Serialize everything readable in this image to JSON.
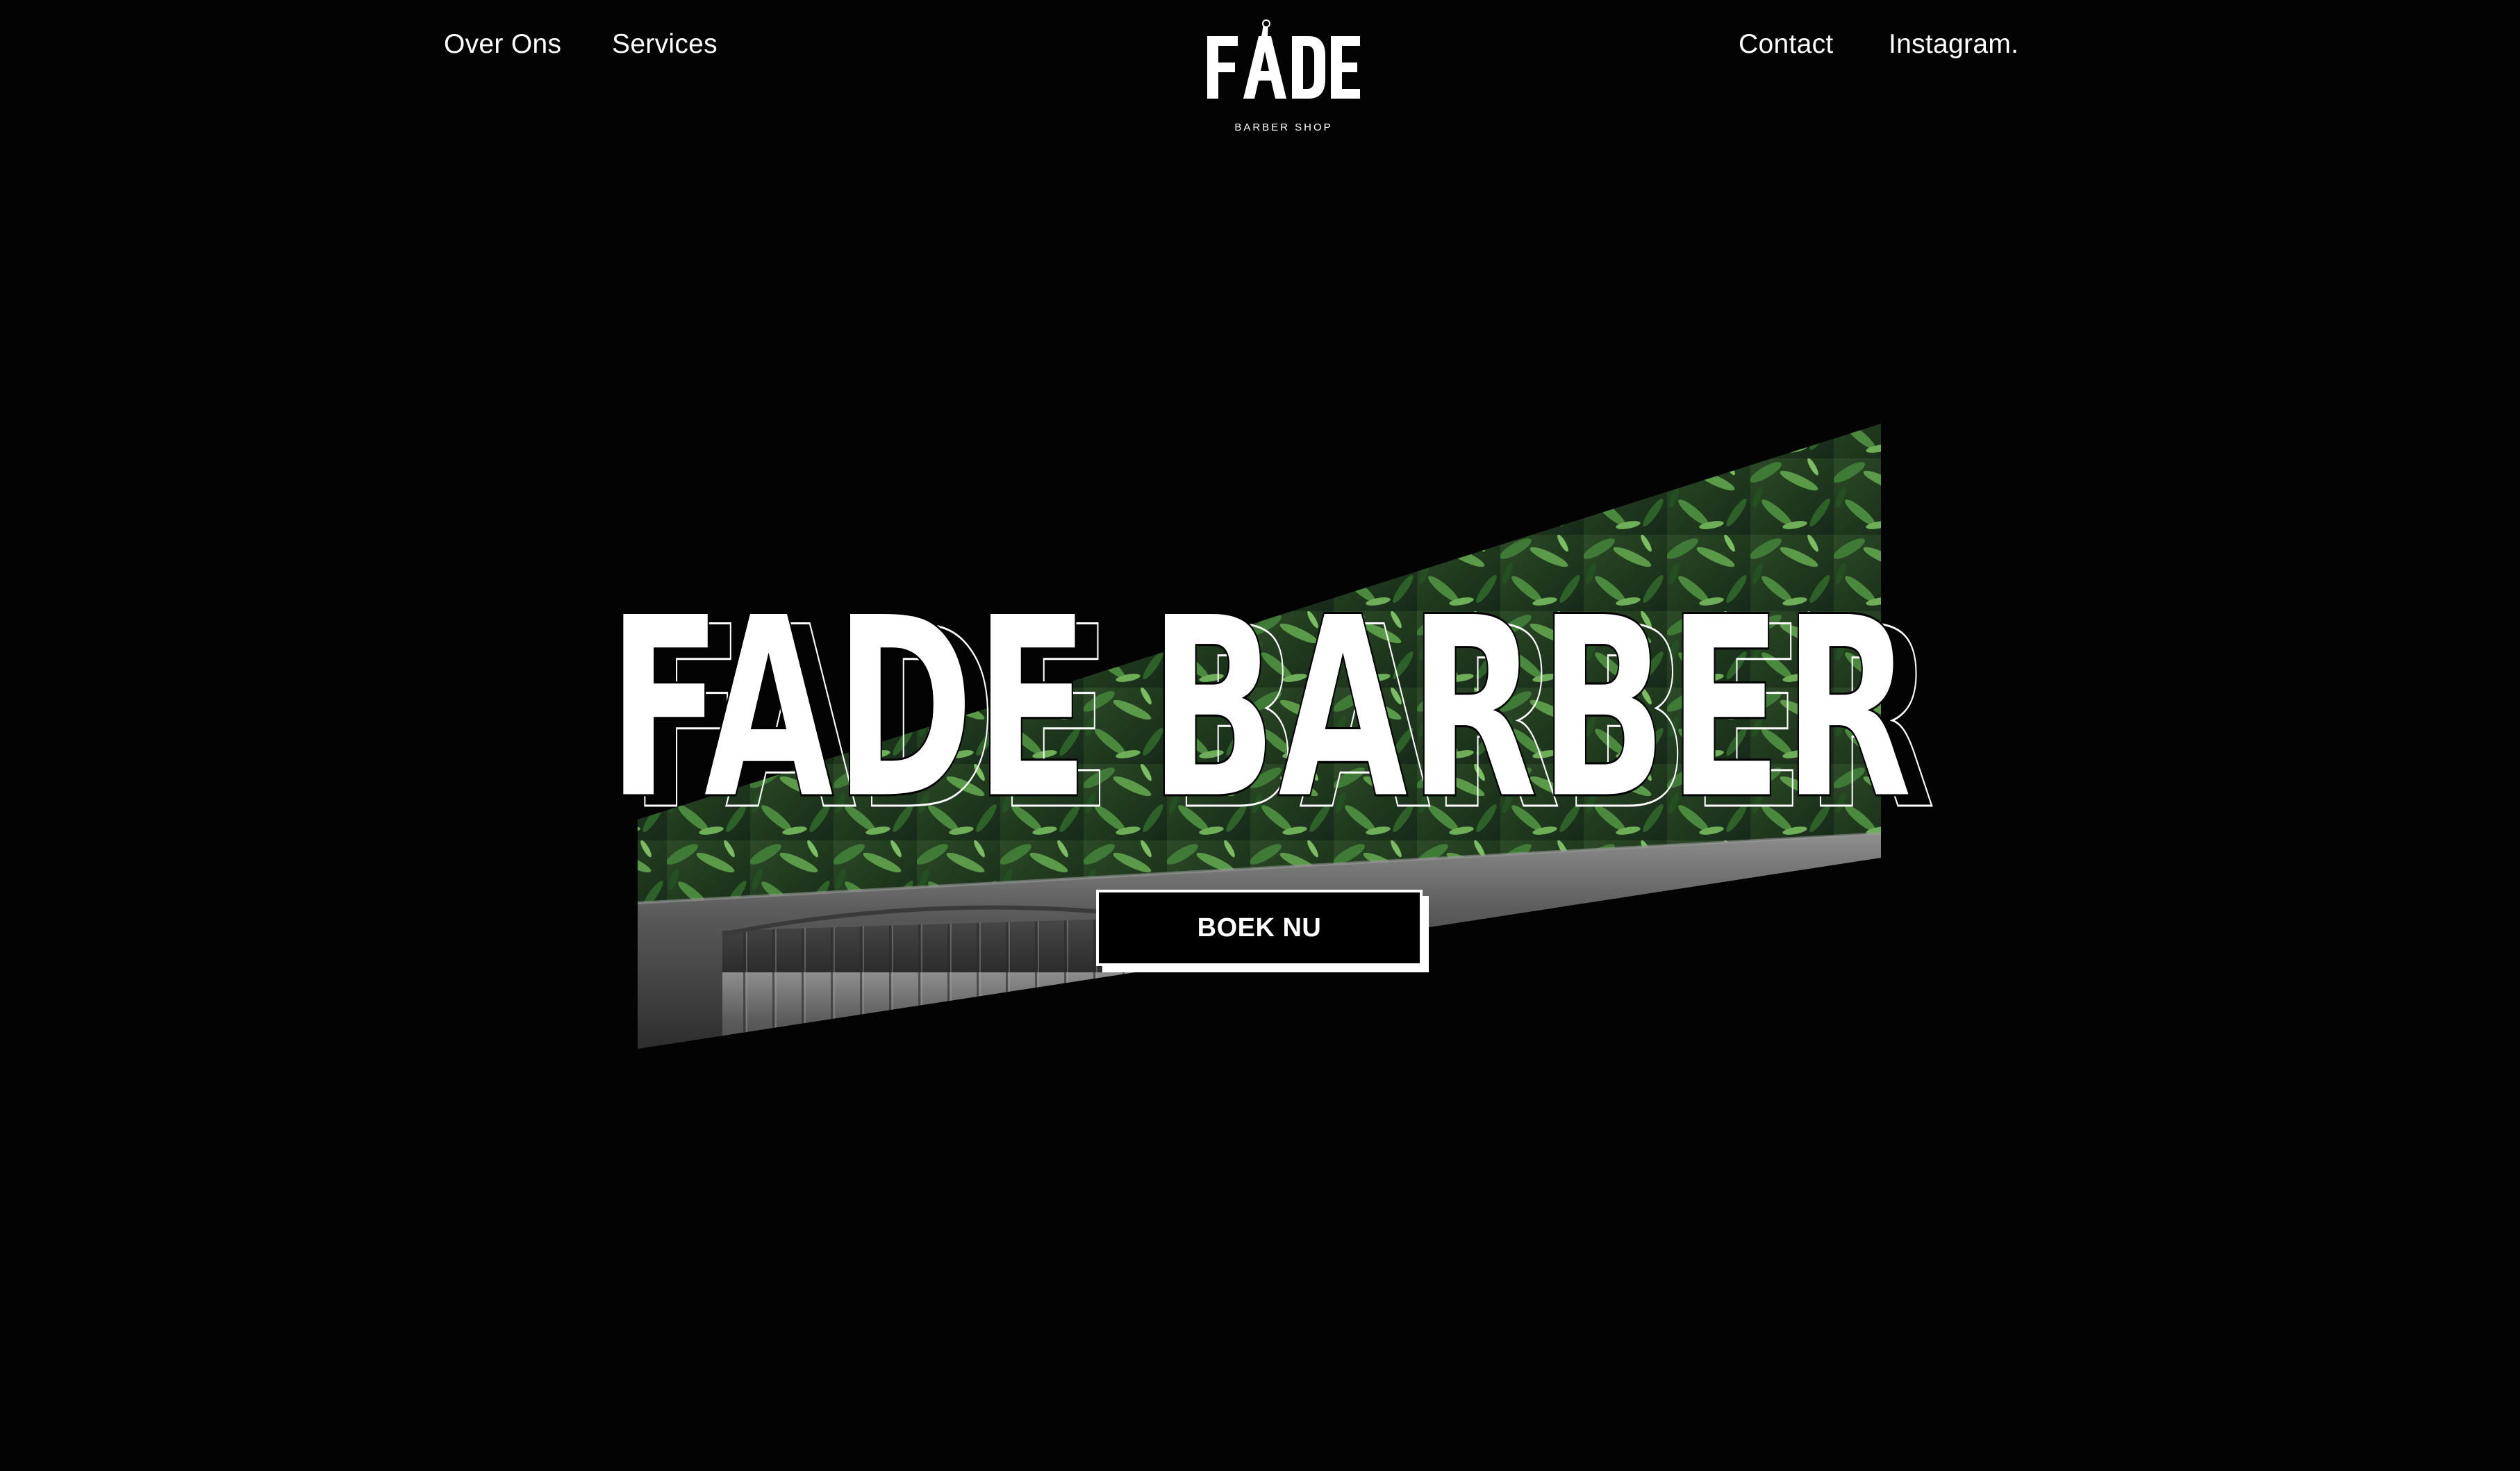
{
  "nav": {
    "left": [
      {
        "label": "Over Ons"
      },
      {
        "label": "Services"
      }
    ],
    "right": [
      {
        "label": "Contact"
      },
      {
        "label": "Instagram."
      }
    ]
  },
  "logo": {
    "wordmark": "FADE",
    "tagline": "BARBER SHOP"
  },
  "hero": {
    "title": "FADE BARBER",
    "image_subject": "plant wall and grey tufted leather bench",
    "cta_label": "BOEK NU"
  },
  "colors": {
    "background": "#030303",
    "text": "#ffffff",
    "button_background": "#000000",
    "button_border": "#ffffff",
    "foliage": "#2f5a2a"
  }
}
